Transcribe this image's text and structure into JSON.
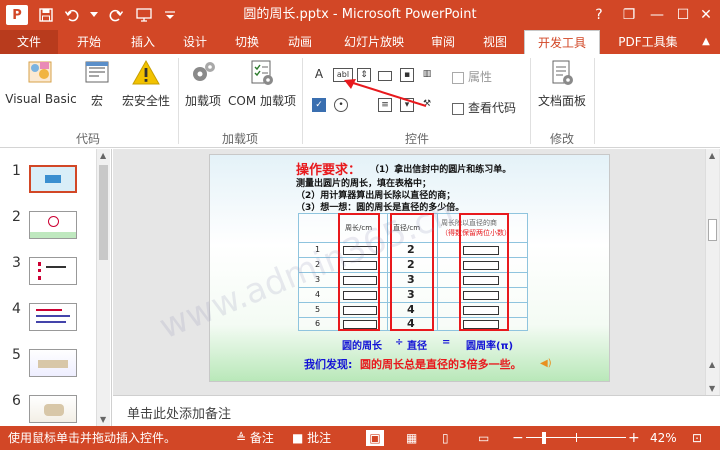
{
  "titlebar": {
    "app_icon": "P",
    "title": "圆的周长.pptx - Microsoft PowerPoint",
    "help": "?",
    "restore": "❐",
    "minimize": "—",
    "maximize": "☐",
    "close": "✕"
  },
  "tabs": [
    {
      "label": "文件"
    },
    {
      "label": "开始"
    },
    {
      "label": "插入"
    },
    {
      "label": "设计"
    },
    {
      "label": "切换"
    },
    {
      "label": "动画"
    },
    {
      "label": "幻灯片放映"
    },
    {
      "label": "审阅"
    },
    {
      "label": "视图"
    },
    {
      "label": "开发工具"
    },
    {
      "label": "PDF工具集"
    }
  ],
  "ribbon": {
    "visual_basic": "Visual Basic",
    "macro": "宏",
    "macro_security": "宏安全性",
    "addins": "加载项",
    "com_addins": "COM 加载项",
    "properties": "属性",
    "view_code": "查看代码",
    "document_panel": "文档面板",
    "group_code": "代码",
    "group_addins": "加载项",
    "group_controls": "控件",
    "group_modify": "修改",
    "label_glyph": "A",
    "textbox_glyph": "abl"
  },
  "slides": [
    {
      "num": "1"
    },
    {
      "num": "2"
    },
    {
      "num": "3"
    },
    {
      "num": "4"
    },
    {
      "num": "5"
    },
    {
      "num": "6"
    }
  ],
  "slide": {
    "requirement_title": "操作要求：",
    "requirement_line1": "（1）拿出信封中的圆片和练习单。",
    "requirement_line2": "测量出圆片的周长，填在表格中；",
    "requirement_line3": "（2）用计算器算出周长除以直径的商；",
    "requirement_line4": "（3）想一想：圆的周长是直径的多少倍。",
    "col_circumference": "周长/cm",
    "col_diameter": "直径/cm",
    "col_quotient_1": "周长除以直径的商",
    "col_quotient_2": "（得数保留两位小数）",
    "rows": [
      {
        "no": "1",
        "diameter": "2"
      },
      {
        "no": "2",
        "diameter": "2"
      },
      {
        "no": "3",
        "diameter": "3"
      },
      {
        "no": "4",
        "diameter": "3"
      },
      {
        "no": "5",
        "diameter": "4"
      },
      {
        "no": "6",
        "diameter": "4"
      }
    ],
    "formula_circumference": "圆的周长",
    "formula_divide": "÷",
    "formula_diameter": "直径",
    "formula_equals": "=",
    "formula_pi": "圆周率(π)",
    "finding_prefix": "我们发现:",
    "finding_text": "圆的周长总是直径的3倍多一些。"
  },
  "notes_placeholder": "单击此处添加备注",
  "status": {
    "hint": "使用鼠标单击并拖动插入控件。",
    "notes": "备注",
    "comments": "批注",
    "zoom_minus": "−",
    "zoom_plus": "+",
    "zoom": "42%"
  },
  "watermark": "www.admin365.cn",
  "colors": {
    "accent": "#d24726",
    "slide_red": "#e8191d",
    "slide_blue": "#1414d6",
    "table_line": "#8fc4de"
  }
}
